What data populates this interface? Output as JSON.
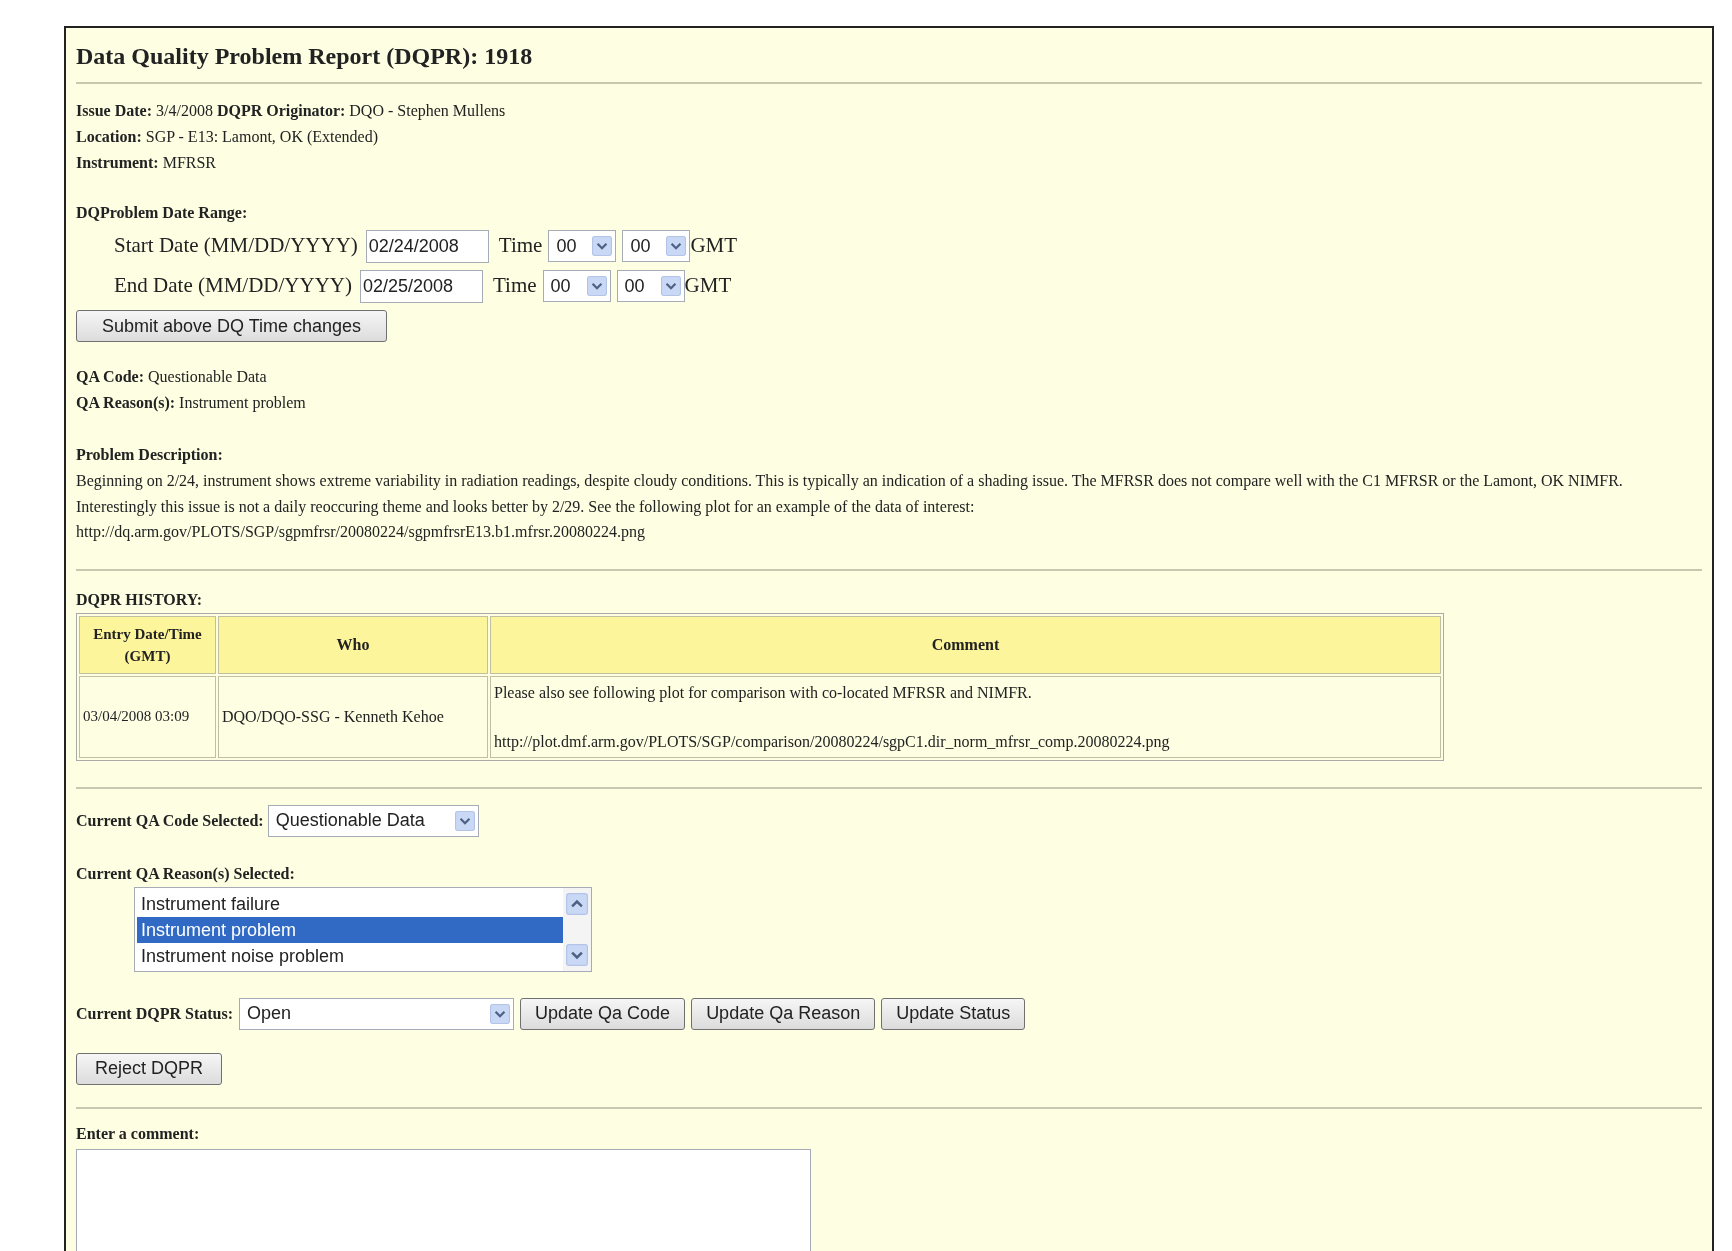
{
  "title": "Data Quality Problem Report (DQPR): 1918",
  "info_lines": [
    "**Issue Date:** 3/4/2008 **DQPR Originator:** DQO - Stephen Mullens",
    "**Location:** SGP - E13: Lamont, OK (Extended)",
    "**Instrument:** MFRSR"
  ],
  "date_range": {
    "label": "DQProblem Date Range:",
    "rows": [
      {
        "label": "Start Date (MM/DD/YYYY)",
        "date": "02/24/2008",
        "time_label": "Time",
        "hour": "00",
        "minute": "00",
        "zone": "GMT"
      },
      {
        "label": "End Date (MM/DD/YYYY)",
        "date": "02/25/2008",
        "time_label": "Time",
        "hour": "00",
        "minute": "00",
        "zone": "GMT"
      }
    ]
  },
  "submit_button": "Submit above DQ Time changes",
  "qa_lines": [
    "**QA Code:** Questionable Data",
    "**QA Reason(s):** Instrument problem"
  ],
  "problem": {
    "label": "Problem Description:",
    "text": "Beginning on 2/24, instrument shows extreme variability in radiation readings, despite cloudy conditions. This is typically an indication of a shading issue. The MFRSR does not compare well with the C1 MFRSR or the Lamont, OK NIMFR. Interestingly this issue is not a daily reoccuring theme and looks better by 2/29. See the following plot for an example of the data of interest:",
    "url": "http://dq.arm.gov/PLOTS/SGP/sgpmfrsr/20080224/sgpmfrsrE13.b1.mfrsr.20080224.png"
  },
  "history": {
    "title": "DQPR HISTORY:",
    "columns": [
      "Entry Date/Time (GMT)",
      "Who",
      "Comment"
    ],
    "rows": [
      {
        "entry": "03/04/2008 03:09",
        "who": "DQO/DQO-SSG - Kenneth Kehoe",
        "comment": [
          "Please also see following plot for comparison with co-located MFRSR and NIMFR.",
          "http://plot.dmf.arm.gov/PLOTS/SGP/comparison/20080224/sgpC1.dir_norm_mfrsr_comp.20080224.png"
        ]
      }
    ]
  },
  "qa_code": {
    "label": "Current QA Code Selected:",
    "value": "Questionable Data"
  },
  "qa_reasons": {
    "label": "Current QA Reason(s) Selected:",
    "options": [
      {
        "text": "Instrument failure",
        "selected": false
      },
      {
        "text": "Instrument problem",
        "selected": true
      },
      {
        "text": "Instrument noise problem",
        "selected": false
      }
    ]
  },
  "status": {
    "label": "Current DQPR Status:",
    "value": "Open"
  },
  "action_buttons": [
    "Update Qa Code",
    "Update Qa Reason",
    "Update Status"
  ],
  "reject_button": "Reject DQPR",
  "comment": {
    "label": "Enter a comment:"
  }
}
